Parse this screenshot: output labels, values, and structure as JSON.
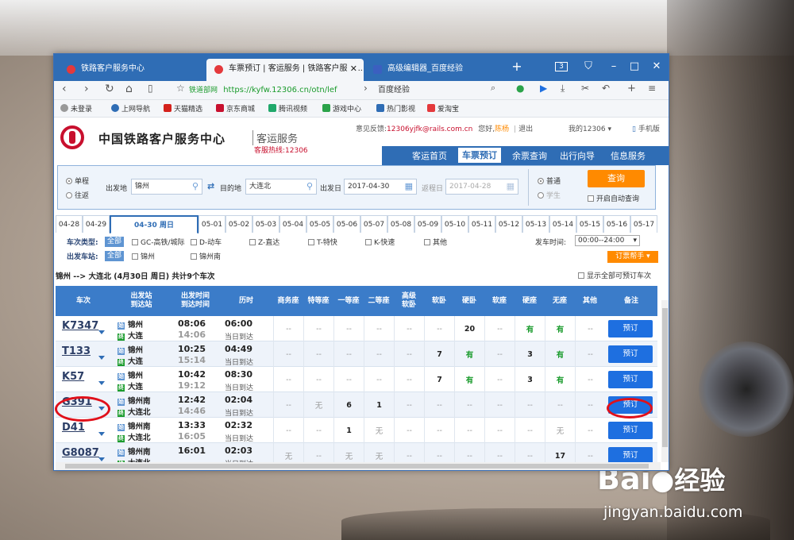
{
  "watermark": {
    "brand": "Bai",
    "brand2": "经验",
    "url": "jingyan.baidu.com"
  },
  "browser": {
    "tabs": [
      {
        "label": "铁路客户服务中心",
        "color": "#e4393c"
      },
      {
        "label": "车票预订 | 客运服务 | 铁路客户服务...",
        "color": "#e4393c"
      },
      {
        "label": "高级编辑器_百度经验",
        "color": "#3b5fc0"
      }
    ],
    "tab_count": "3",
    "url_site": "铁道部网",
    "url": "https://kyfw.12306.cn/otn/lef",
    "search": "百度经验",
    "bookmarks": [
      {
        "label": "未登录",
        "color": "#999999"
      },
      {
        "label": "上网导航",
        "color": "#2f6db5"
      },
      {
        "label": "天猫精选",
        "color": "#d4221c"
      },
      {
        "label": "京东商城",
        "color": "#c8102e"
      },
      {
        "label": "腾讯视频",
        "color": "#20a86b"
      },
      {
        "label": "游戏中心",
        "color": "#2ba34a"
      },
      {
        "label": "热门影视",
        "color": "#2f6db5"
      },
      {
        "label": "爱淘宝",
        "color": "#e4393c"
      }
    ]
  },
  "site": {
    "title": "中国铁路客户服务中心",
    "subtitle": "客运服务",
    "hotline": "客服热线:12306",
    "feedback": "意见反馈:",
    "email": "12306yjfk@rails.com.cn",
    "greeting": "您好,",
    "user": "陈杨",
    "logout": "退出",
    "my12306": "我的12306",
    "mobile": "手机版",
    "nav": [
      "客运首页",
      "车票预订",
      "余票查询",
      "出行向导",
      "信息服务"
    ]
  },
  "query": {
    "trip_types": [
      "单程",
      "往返"
    ],
    "from_label": "出发地",
    "from": "锦州",
    "to_label": "目的地",
    "to": "大连北",
    "date_label": "出发日",
    "date": "2017-04-30",
    "return_label": "返程日",
    "return_date": "2017-04-28",
    "ticket_types": [
      "普通",
      "学生"
    ],
    "search_label": "查询",
    "auto_label": "开启自动查询"
  },
  "dates": [
    "04-28",
    "04-29",
    "04-30 周日",
    "05-01",
    "05-02",
    "05-03",
    "05-04",
    "05-05",
    "05-06",
    "05-07",
    "05-08",
    "05-09",
    "05-10",
    "05-11",
    "05-12",
    "05-13",
    "05-14",
    "05-15",
    "05-16",
    "05-17"
  ],
  "filters": {
    "type_label": "车次类型:",
    "all_label": "全部",
    "types": [
      "GC-高铁/城际",
      "D-动车",
      "Z-直达",
      "T-特快",
      "K-快速",
      "其他"
    ],
    "station_label": "出发车站:",
    "stations": [
      "锦州",
      "锦州南"
    ],
    "time_label": "发车时间:",
    "time_value": "00:00--24:00",
    "helper_label": "订票帮手"
  },
  "summary": {
    "route": "锦州 --> 大连北 (4月30日 周日) 共计9个车次",
    "show_all": "显示全部可预订车次"
  },
  "table": {
    "headers": [
      "车次",
      "出发站\n到达站",
      "出发时间\n到达时间",
      "历时",
      "商务座",
      "特等座",
      "一等座",
      "二等座",
      "高级\n软卧",
      "软卧",
      "硬卧",
      "软座",
      "硬座",
      "无座",
      "其他",
      "备注"
    ],
    "rows": [
      {
        "no": "K7347",
        "from": "锦州",
        "to": "大连",
        "dep": "08:06",
        "arr": "14:06",
        "dur": "06:00",
        "day": "当日到达",
        "seats": [
          "--",
          "--",
          "--",
          "--",
          "--",
          "--",
          "20",
          "--",
          "有",
          "有",
          "--"
        ],
        "book": "预订"
      },
      {
        "no": "T133",
        "from": "锦州",
        "to": "大连",
        "dep": "10:25",
        "arr": "15:14",
        "dur": "04:49",
        "day": "当日到达",
        "seats": [
          "--",
          "--",
          "--",
          "--",
          "--",
          "7",
          "有",
          "--",
          "3",
          "有",
          "--"
        ],
        "book": "预订"
      },
      {
        "no": "K57",
        "from": "锦州",
        "to": "大连",
        "dep": "10:42",
        "arr": "19:12",
        "dur": "08:30",
        "day": "当日到达",
        "seats": [
          "--",
          "--",
          "--",
          "--",
          "--",
          "7",
          "有",
          "--",
          "3",
          "有",
          "--"
        ],
        "book": "预订"
      },
      {
        "no": "G391",
        "from": "锦州南",
        "to": "大连北",
        "dep": "12:42",
        "arr": "14:46",
        "dur": "02:04",
        "day": "当日到达",
        "seats": [
          "--",
          "无",
          "6",
          "1",
          "--",
          "--",
          "--",
          "--",
          "--",
          "--",
          "--"
        ],
        "book": "预订"
      },
      {
        "no": "D41",
        "from": "锦州南",
        "to": "大连北",
        "dep": "13:33",
        "arr": "16:05",
        "dur": "02:32",
        "day": "当日到达",
        "seats": [
          "--",
          "--",
          "1",
          "无",
          "--",
          "--",
          "--",
          "--",
          "--",
          "无",
          "--"
        ],
        "book": "预订"
      },
      {
        "no": "G8087",
        "from": "锦州南",
        "to": "大连北",
        "dep": "16:01",
        "arr": "",
        "dur": "02:03",
        "day": "当日到达",
        "seats": [
          "无",
          "--",
          "无",
          "无",
          "--",
          "--",
          "--",
          "--",
          "--",
          "17",
          "--"
        ],
        "book": "预订"
      }
    ]
  }
}
